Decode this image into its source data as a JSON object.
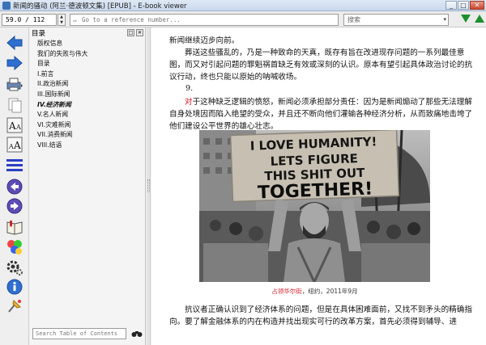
{
  "window": {
    "title": "新闻的骚动 (阿兰·德波顿文集) [EPUB] - E-book viewer",
    "minimize": "_",
    "maximize": "□",
    "close": "✕"
  },
  "toolbar": {
    "position_value": "59.0 / 112",
    "reference_placeholder": "Go to a reference number...",
    "go_label": "⇨",
    "search_placeholder": "搜索",
    "search_dropdown": "▾"
  },
  "sidebar_icons": [
    "back-icon",
    "forward-icon",
    "print-icon",
    "copy-icon",
    "font-larger-icon",
    "font-smaller-icon",
    "toc-toggle-icon",
    "previous-page-icon",
    "next-page-icon",
    "bookmark-icon",
    "theme-icon",
    "preferences-icon",
    "info-icon",
    "pin-icon"
  ],
  "toc": {
    "title": "目录",
    "close_label": "✕",
    "float_label": "□",
    "items": [
      {
        "label": "版权信息",
        "active": false
      },
      {
        "label": "我们的失败与伟大",
        "active": false
      },
      {
        "label": "目录",
        "active": false
      },
      {
        "label": "I.前言",
        "active": false
      },
      {
        "label": "II.政治新闻",
        "active": false
      },
      {
        "label": "III.国际新闻",
        "active": false
      },
      {
        "label": "IV.经济新闻",
        "active": true
      },
      {
        "label": "V.名人新闻",
        "active": false
      },
      {
        "label": "VI.灾难新闻",
        "active": false
      },
      {
        "label": "VII.消费新闻",
        "active": false
      },
      {
        "label": "VIII.结语",
        "active": false
      }
    ],
    "search_placeholder": "Search Table of Contents"
  },
  "content": {
    "para1": "新闻继续迈步向前。",
    "para2": "葬送这些骚乱的，乃是一种致命的天真，既存有旨在改进现存问题的一系列最佳意图，而又对引起问题的罪魁祸首缺乏有效或深刻的认识。原本有望引起具体政治讨论的抗议行动，终也只能以原始的呐喊收场。",
    "number": "9.",
    "para3_first": "对",
    "para3_rest": "于这种缺乏逻辑的愤怒，新闻必须承担部分责任：因为是新闻煽动了那些无法理解自身处境因而陷入绝望的受众，并且还不断向他们灌输各种经济分析，从而致痛地击垮了他们建设公平世界的雄心壮志。",
    "photo_sign": "I LOVE HUMANITY! LETS FIGURE THIS SHIT OUT TOGETHER!",
    "caption_place": "占领华尔街",
    "caption_rest": "，纽约，2011年9月",
    "para4": "抗议者正确认识到了经济体系的问题，但是在具体困难面前，又找不到矛头的精确指向。要了解金融体系的内在构造并找出现实可行的改革方案，首先必须得到辅导、进"
  },
  "colors": {
    "accent_red": "#d8212d",
    "nav_green": "#1d8f2e",
    "icon_blue": "#2f6fd0",
    "toc_icon_blue": "#2b3fc4",
    "nav_purple": "#5e4bb5"
  }
}
